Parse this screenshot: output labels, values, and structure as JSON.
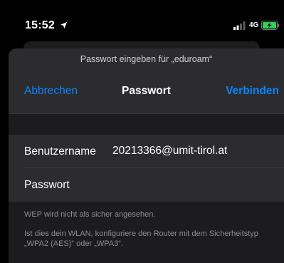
{
  "status_bar": {
    "time": "15:52",
    "network": "4G",
    "icons": [
      "location-arrow",
      "signal-bars",
      "battery-charging"
    ],
    "battery_color": "#30d158"
  },
  "sheet": {
    "prompt": "Passwort eingeben für „eduroam“",
    "cancel_label": "Abbrechen",
    "title": "Passwort",
    "connect_label": "Verbinden",
    "accent_color": "#0a84ff"
  },
  "form": {
    "username_label": "Benutzername",
    "username_value": "20213366@umit-tirol.at",
    "password_label": "Passwort",
    "password_value": ""
  },
  "notes": {
    "warning": "WEP wird nicht als sicher angesehen.",
    "advice": "Ist dies dein WLAN, konfiguriere den Router mit dem Sicherheitstyp „WPA2 (AES)“ oder „WPA3“."
  }
}
